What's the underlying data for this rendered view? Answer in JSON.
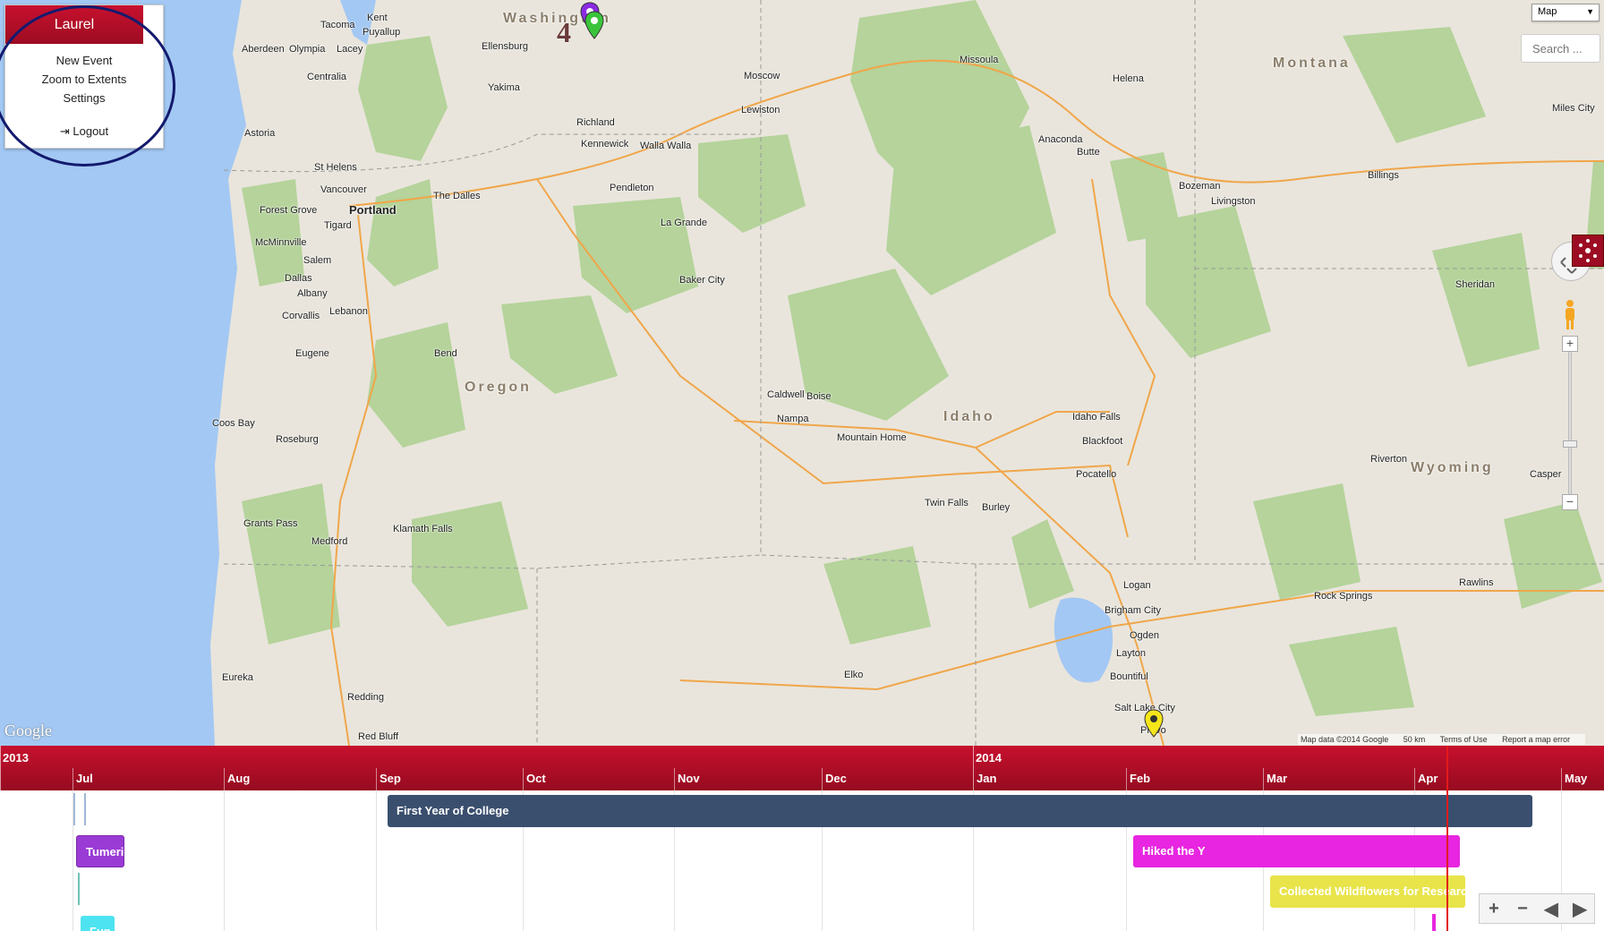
{
  "user_menu": {
    "username": "Laurel",
    "items": [
      "New Event",
      "Zoom to Extents",
      "Settings"
    ],
    "logout": "Logout"
  },
  "map_controls": {
    "map_type": "Map",
    "search_placeholder": "Search ...",
    "zoom_in": "+",
    "zoom_out": "−"
  },
  "map": {
    "states": [
      "Washington",
      "Montana",
      "Oregon",
      "Idaho",
      "Wyoming"
    ],
    "cities": [
      "Tacoma",
      "Kent",
      "Puyallup",
      "Aberdeen",
      "Olympia",
      "Lacey",
      "Ellensburg",
      "Yakima",
      "Centralia",
      "Richland",
      "Kennewick",
      "Walla Walla",
      "Moscow",
      "Lewiston",
      "Missoula",
      "Helena",
      "Miles City",
      "Billings",
      "Bozeman",
      "Butte",
      "Anaconda",
      "Livingston",
      "Astoria",
      "St Helens",
      "Vancouver",
      "Portland",
      "Forest Grove",
      "Tigard",
      "McMinnville",
      "Salem",
      "Dallas",
      "Albany",
      "Corvallis",
      "Lebanon",
      "Eugene",
      "Bend",
      "The Dalles",
      "Pendleton",
      "La Grande",
      "Baker City",
      "Caldwell",
      "Boise",
      "Nampa",
      "Mountain Home",
      "Twin Falls",
      "Burley",
      "Pocatello",
      "Blackfoot",
      "Idaho Falls",
      "Coos Bay",
      "Roseburg",
      "Grants Pass",
      "Medford",
      "Klamath Falls",
      "Eureka",
      "Redding",
      "Red Bluff",
      "Elko",
      "Logan",
      "Brigham City",
      "Ogden",
      "Layton",
      "Bountiful",
      "Salt Lake City",
      "Provo",
      "Rock Springs",
      "Rawlins",
      "Riverton",
      "Casper",
      "Sheridan"
    ],
    "attribution": "Map data ©2014 Google",
    "scale": "50 km",
    "terms": "Terms of Use",
    "report": "Report a map error",
    "logo": "Google",
    "marker_count": "4"
  },
  "timeline": {
    "years": [
      "2013",
      "2014"
    ],
    "months": [
      "Jul",
      "Aug",
      "Sep",
      "Oct",
      "Nov",
      "Dec",
      "Jan",
      "Feb",
      "Mar",
      "Apr",
      "May"
    ],
    "events": [
      {
        "label": "First Year of College",
        "color": "#3a4f6e"
      },
      {
        "label": "Tumeric",
        "color": "#9b3bd6"
      },
      {
        "label": "Hiked the Y",
        "color": "#e825e0"
      },
      {
        "label": "Collected Wildflowers for Research",
        "color": "#e8e44a"
      },
      {
        "label": "Fun",
        "color": "#4ee3f0"
      }
    ],
    "controls": [
      "+",
      "−",
      "◀",
      "▶"
    ]
  }
}
